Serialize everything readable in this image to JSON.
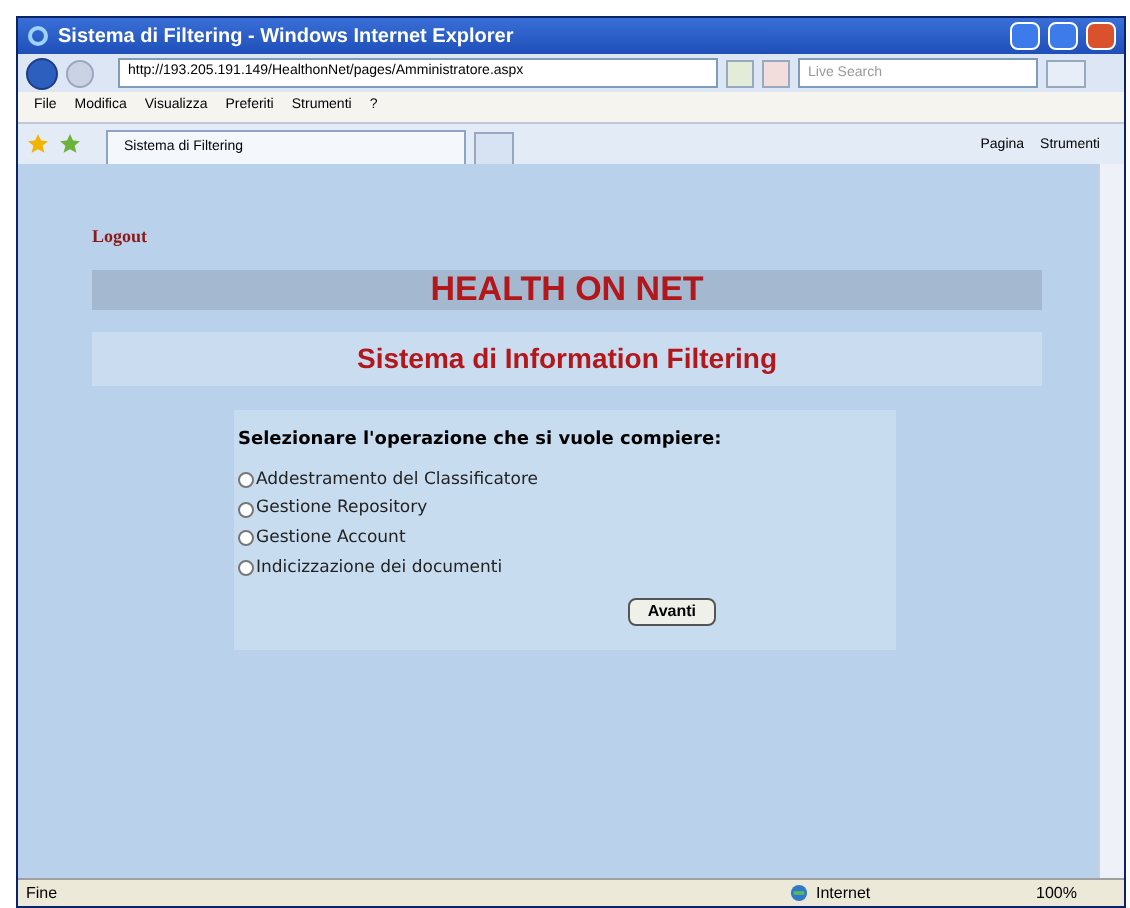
{
  "window": {
    "title": "Sistema di Filtering - Windows Internet Explorer"
  },
  "address_bar": {
    "url": "http://193.205.191.149/HealthonNet/pages/Amministratore.aspx"
  },
  "search": {
    "placeholder": "Live Search"
  },
  "menu": [
    "File",
    "Modifica",
    "Visualizza",
    "Preferiti",
    "Strumenti",
    "?"
  ],
  "tabs": [
    {
      "label": "Sistema di Filtering",
      "selected": true
    }
  ],
  "toolbar": [
    "Pagina",
    "Strumenti"
  ],
  "page": {
    "logout": "Logout",
    "banner": "HEALTH ON NET",
    "subtitle": "Sistema di Information Filtering",
    "prompt": "Selezionare l'operazione che si vuole compiere:",
    "options": [
      {
        "label": "Addestramento del Classificatore",
        "checked": false
      },
      {
        "label": "Gestione Repository",
        "checked": false
      },
      {
        "label": "Gestione Account",
        "checked": false
      },
      {
        "label": "Indicizzazione dei documenti",
        "checked": false
      }
    ],
    "button": "Avanti"
  },
  "status_bar": {
    "text": "Fine",
    "zone": "Internet",
    "zoom": "100%"
  }
}
